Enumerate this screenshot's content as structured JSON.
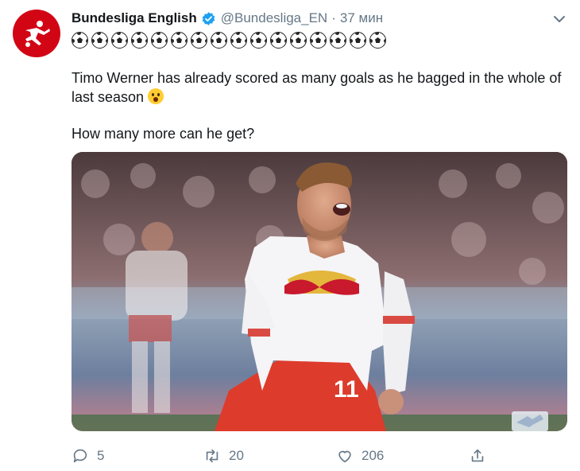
{
  "author": {
    "display_name": "Bundesliga English",
    "handle": "@Bundesliga_EN",
    "separator": "·",
    "time": "37 мин"
  },
  "colors": {
    "avatar_bg": "#d20515",
    "verified": "#1da1f2",
    "muted": "#657786"
  },
  "emoji_row": {
    "icon": "soccer-ball-icon",
    "count": 16
  },
  "tweet": {
    "line1": "Timo Werner has already scored as many goals as he bagged in the whole of",
    "line2": "last season",
    "line2_emoji": "astonished-face-icon",
    "line3": "How many more can he get?"
  },
  "media": {
    "type": "photo",
    "jersey_number": "11"
  },
  "actions": {
    "replies": "5",
    "retweets": "20",
    "likes": "206"
  }
}
